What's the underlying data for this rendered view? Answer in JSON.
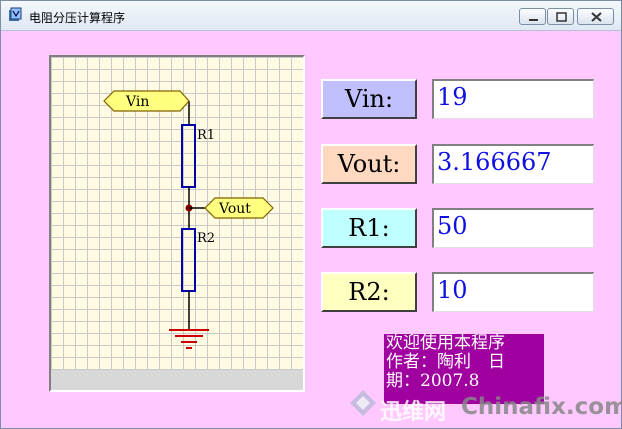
{
  "window": {
    "title": "电阻分压计算程序"
  },
  "diagram": {
    "vin_tag": "Vin",
    "vout_tag": "Vout",
    "r1_label": "R1",
    "r2_label": "R2"
  },
  "fields": [
    {
      "label": "Vin:",
      "value": "19"
    },
    {
      "label": "Vout:",
      "value": "3.166667"
    },
    {
      "label": "R1:",
      "value": "50"
    },
    {
      "label": "R2:",
      "value": "10"
    }
  ],
  "info": {
    "line1": "欢迎使用本程序",
    "line2": "作者：陶利　日",
    "line3": "期：2007.8"
  },
  "watermark": {
    "cn": "迅维网",
    "en": "Chinafix.com"
  },
  "colors": {
    "background": "#ffc8ff",
    "vin_button": "#c0c0ff",
    "vout_button": "#ffd8c0",
    "r1_button": "#c0ffff",
    "r2_button": "#ffffc0",
    "field_text": "#1010e0",
    "info_bg": "#a000a0"
  }
}
